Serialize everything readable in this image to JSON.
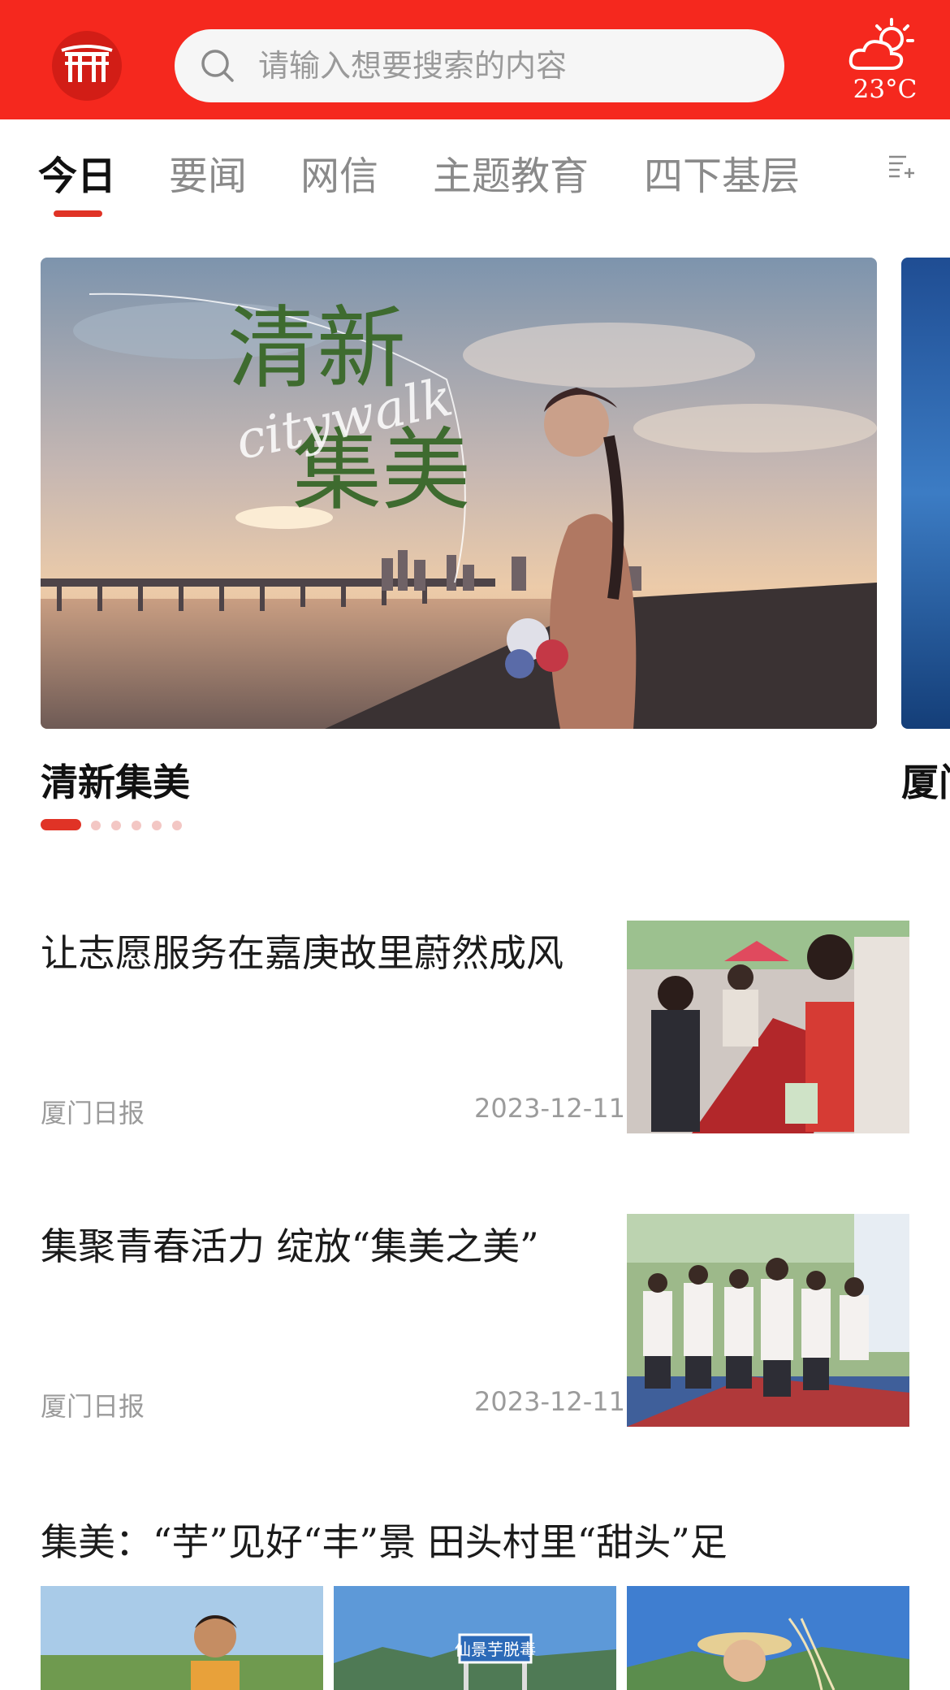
{
  "header": {
    "logo_icon": "gate-archway-icon",
    "search_placeholder": "请输入想要搜索的内容",
    "weather_icon": "partly-cloudy-icon",
    "temperature": "23°C",
    "colors": {
      "brand_red": "#f5281e",
      "accent_red": "#e03326"
    }
  },
  "tabs": {
    "items": [
      {
        "label": "今日",
        "active": true
      },
      {
        "label": "要闻",
        "active": false
      },
      {
        "label": "网信",
        "active": false
      },
      {
        "label": "主题教育",
        "active": false
      },
      {
        "label": "四下基层",
        "active": false
      }
    ],
    "more_icon": "channel-list-icon"
  },
  "carousel": {
    "current_title": "清新集美",
    "next_title_partial": "厦门",
    "slide_count": 6,
    "active_index": 0,
    "overlay_text": {
      "line1": "清新",
      "line2": "集美",
      "script": "citywalk"
    }
  },
  "news": [
    {
      "title": "让志愿服务在嘉庚故里蔚然成风",
      "source": "厦门日报",
      "date": "2023-12-11"
    },
    {
      "title": "集聚青春活力 绽放“集美之美”",
      "source": "厦门日报",
      "date": "2023-12-11"
    }
  ],
  "multi_news": {
    "title": "集美：“芋”见好“丰”景 田头村里“甜头”足",
    "sign_text": "仙景芋脱毒"
  }
}
